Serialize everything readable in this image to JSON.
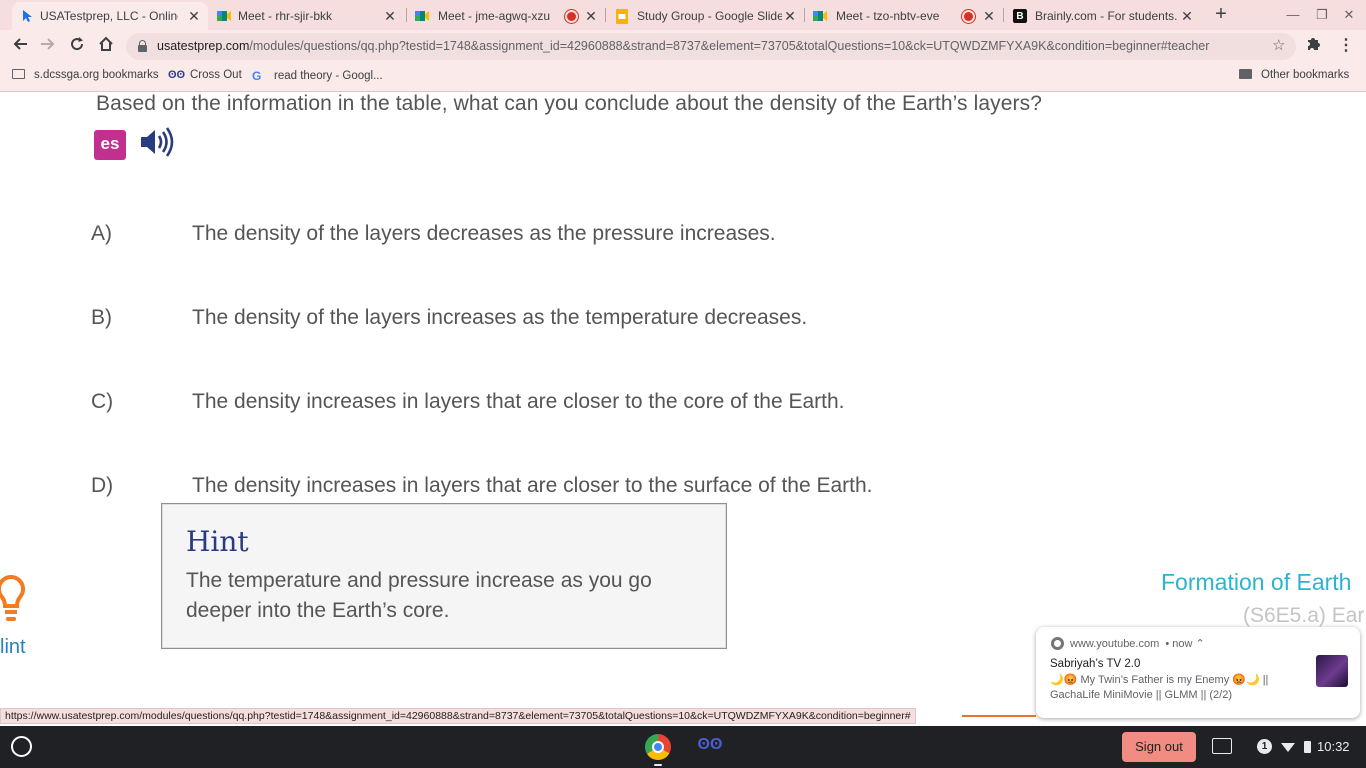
{
  "browser": {
    "tabs": [
      {
        "title": "USATestprep, LLC - Online Sta",
        "icon": "cursor-icon",
        "active": true,
        "recording": false
      },
      {
        "title": "Meet - rhr-sjir-bkk",
        "icon": "meet-icon",
        "active": false,
        "recording": false
      },
      {
        "title": "Meet - jme-agwq-xzu",
        "icon": "meet-icon",
        "active": false,
        "recording": true
      },
      {
        "title": "Study Group - Google Slides",
        "icon": "slides-icon",
        "active": false,
        "recording": false
      },
      {
        "title": "Meet - tzo-nbtv-eve",
        "icon": "meet-icon",
        "active": false,
        "recording": true
      },
      {
        "title": "Brainly.com - For students. B",
        "icon": "brainly-icon",
        "active": false,
        "recording": false
      }
    ],
    "url_host": "usatestprep.com",
    "url_path": "/modules/questions/qq.php?testid=1748&assignment_id=42960888&strand=8737&element=73705&totalQuestions=10&ck=UTQWDZMFYXA9K&condition=beginner#teacher",
    "bookmarks": [
      {
        "label": "s.dcssga.org bookmarks",
        "icon": "folder-icon"
      },
      {
        "label": "Cross Out",
        "icon": "owl-icon"
      },
      {
        "label": "read theory - Googl...",
        "icon": "google-icon"
      }
    ],
    "other_bookmarks": "Other bookmarks",
    "status_url": "https://www.usatestprep.com/modules/questions/qq.php?testid=1748&assignment_id=42960888&strand=8737&element=73705&totalQuestions=10&ck=UTQWDZMFYXA9K&condition=beginner#"
  },
  "question": {
    "text": "Based on the information in the table, what can you conclude about the density of the Earth’s layers?",
    "translate_label": "es",
    "choices": [
      {
        "letter": "A)",
        "text": "The density of the layers decreases as the pressure increases."
      },
      {
        "letter": "B)",
        "text": "The density of the layers increases as the temperature decreases."
      },
      {
        "letter": "C)",
        "text": "The density increases in layers that are closer to the core of the Earth."
      },
      {
        "letter": "D)",
        "text": "The density increases in layers that are closer to the surface of the Earth."
      }
    ]
  },
  "hint": {
    "title": "Hint",
    "body": "The temperature and pressure increase as you go deeper into the Earth’s core.",
    "side_label": "lint"
  },
  "topic": {
    "title": "Formation of Earth",
    "standard": "(S6E5.a) Ear"
  },
  "notification": {
    "source": "www.youtube.com",
    "time": "• now ⌃",
    "title": "Sabriyah’s TV 2.0",
    "body": "🌙😡 My Twin’s Father is my Enemy 😡🌙 || GachaLife MiniMovie || GLMM || (2/2)"
  },
  "shelf": {
    "sign_out": "Sign out",
    "notification_count": "1",
    "time": "10:32"
  },
  "colors": {
    "question_text": "#555555",
    "hint_title": "#2a3c80",
    "topic_title": "#2bb3cf",
    "translate_button": "#c0318f",
    "sign_out": "#f28b82"
  }
}
